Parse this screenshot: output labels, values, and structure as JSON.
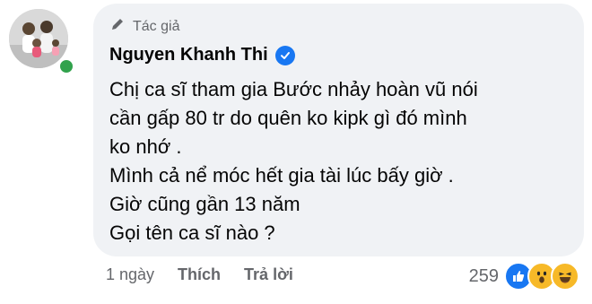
{
  "comment": {
    "role_label": "Tác giả",
    "author_name": "Nguyen Khanh Thi",
    "lines": [
      "Chị ca sĩ tham gia Bước nhảy hoàn vũ nói",
      "cần gấp 80 tr do quên ko kipk gì đó mình",
      "ko nhớ .",
      "Mình cả nể móc hết gia tài lúc bấy giờ .",
      "Giờ cũng gần 13 năm",
      "Gọi tên ca sĩ nào ?"
    ]
  },
  "actions": {
    "time": "1 ngày",
    "like_label": "Thích",
    "reply_label": "Trả lời"
  },
  "reactions": {
    "count": "259",
    "icons": [
      "like-icon",
      "wow-icon",
      "haha-icon"
    ]
  },
  "colors": {
    "bubble": "#f0f2f5",
    "accent": "#1877f2",
    "online": "#31a24c",
    "secondary_text": "#65676b"
  }
}
